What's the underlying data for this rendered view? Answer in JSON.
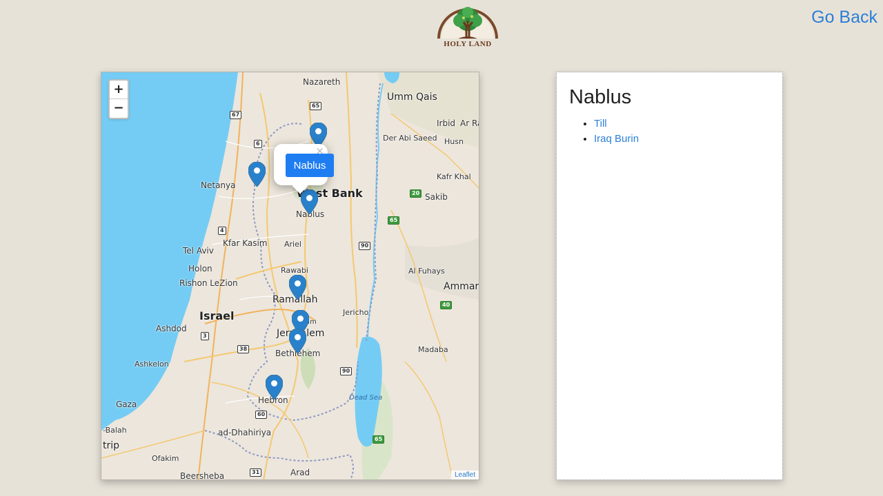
{
  "header": {
    "logo_text": "HOLY LAND",
    "go_back_label": "Go Back"
  },
  "map": {
    "zoom_in_label": "+",
    "zoom_out_label": "−",
    "attribution": "Leaflet",
    "popup": {
      "button_label": "Nablus",
      "close_label": "×"
    },
    "places": {
      "nazareth": "Nazareth",
      "umm_qais": "Umm Qais",
      "irbid": "Irbid",
      "ar_ra": "Ar Ra",
      "der_abi_saeed": "Der Abi Saeed",
      "husn": "Husn",
      "kafr_khal": "Kafr Khal",
      "sakib": "Sakib",
      "netanya": "Netanya",
      "west_bank": "West Bank",
      "nablus": "Nablus",
      "kfar_kasim": "Kfar Kasim",
      "ariel": "Ariel",
      "tel_aviv": "Tel Aviv",
      "holon": "Holon",
      "rishon": "Rishon LeZion",
      "rawabi": "Rawabi",
      "ramallah": "Ramallah",
      "al_fuhays": "Al Fuhays",
      "ammar": "Ammar",
      "israel": "Israel",
      "ashdod": "Ashdod",
      "jericho": "Jericho",
      "ar_ram": "ar-Ram",
      "jerusalem": "Jerusalem",
      "bethlehem": "Bethlehem",
      "ashkelon": "Ashkelon",
      "madaba": "Madaba",
      "dead_sea": "Dead Sea",
      "gaza": "Gaza",
      "hebron": "Hebron",
      "balah": "-Balah",
      "strip": "trip",
      "ad_dhahiriya": "ad-Dhahiriya",
      "ofakim": "Ofakim",
      "beersheba": "Beersheba",
      "arad": "Arad"
    },
    "roads": [
      "67",
      "65",
      "6",
      "4",
      "90",
      "3",
      "38",
      "90",
      "60",
      "31",
      "20",
      "65",
      "40",
      "65"
    ]
  },
  "panel": {
    "title": "Nablus",
    "links": [
      "Till",
      "Iraq Burin"
    ]
  },
  "colors": {
    "link_blue": "#2b7fd8",
    "popup_button": "#1f7df2",
    "marker_blue": "#2a81cb",
    "sea_blue": "#74ccf4",
    "page_background": "#e7e2d8"
  }
}
